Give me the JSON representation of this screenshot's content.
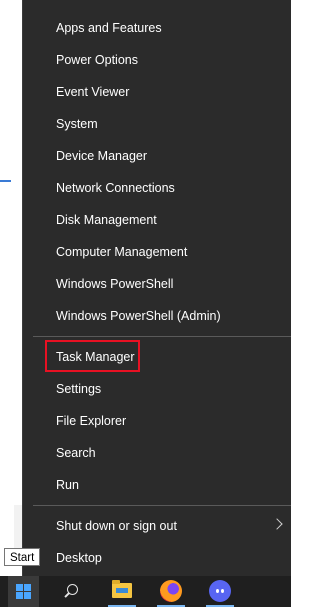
{
  "menu": {
    "items": [
      {
        "label": "Apps and Features"
      },
      {
        "label": "Power Options"
      },
      {
        "label": "Event Viewer"
      },
      {
        "label": "System"
      },
      {
        "label": "Device Manager"
      },
      {
        "label": "Network Connections"
      },
      {
        "label": "Disk Management"
      },
      {
        "label": "Computer Management"
      },
      {
        "label": "Windows PowerShell"
      },
      {
        "label": "Windows PowerShell (Admin)"
      },
      {
        "label": "Task Manager"
      },
      {
        "label": "Settings"
      },
      {
        "label": "File Explorer"
      },
      {
        "label": "Search"
      },
      {
        "label": "Run"
      },
      {
        "label": "Shut down or sign out"
      },
      {
        "label": "Desktop"
      }
    ],
    "highlighted_item": "Task Manager",
    "highlight_color": "#e81123",
    "background_color": "#2b2b2b"
  },
  "tooltip": {
    "text": "Start"
  },
  "taskbar": {
    "background_color": "#1f1f1f",
    "items": [
      {
        "name": "start",
        "icon": "windows-logo-icon"
      },
      {
        "name": "search",
        "icon": "search-icon"
      },
      {
        "name": "file-explorer",
        "icon": "folder-icon"
      },
      {
        "name": "firefox",
        "icon": "firefox-icon"
      },
      {
        "name": "discord",
        "icon": "discord-icon"
      }
    ],
    "accent_color": "#4aa6ff"
  }
}
